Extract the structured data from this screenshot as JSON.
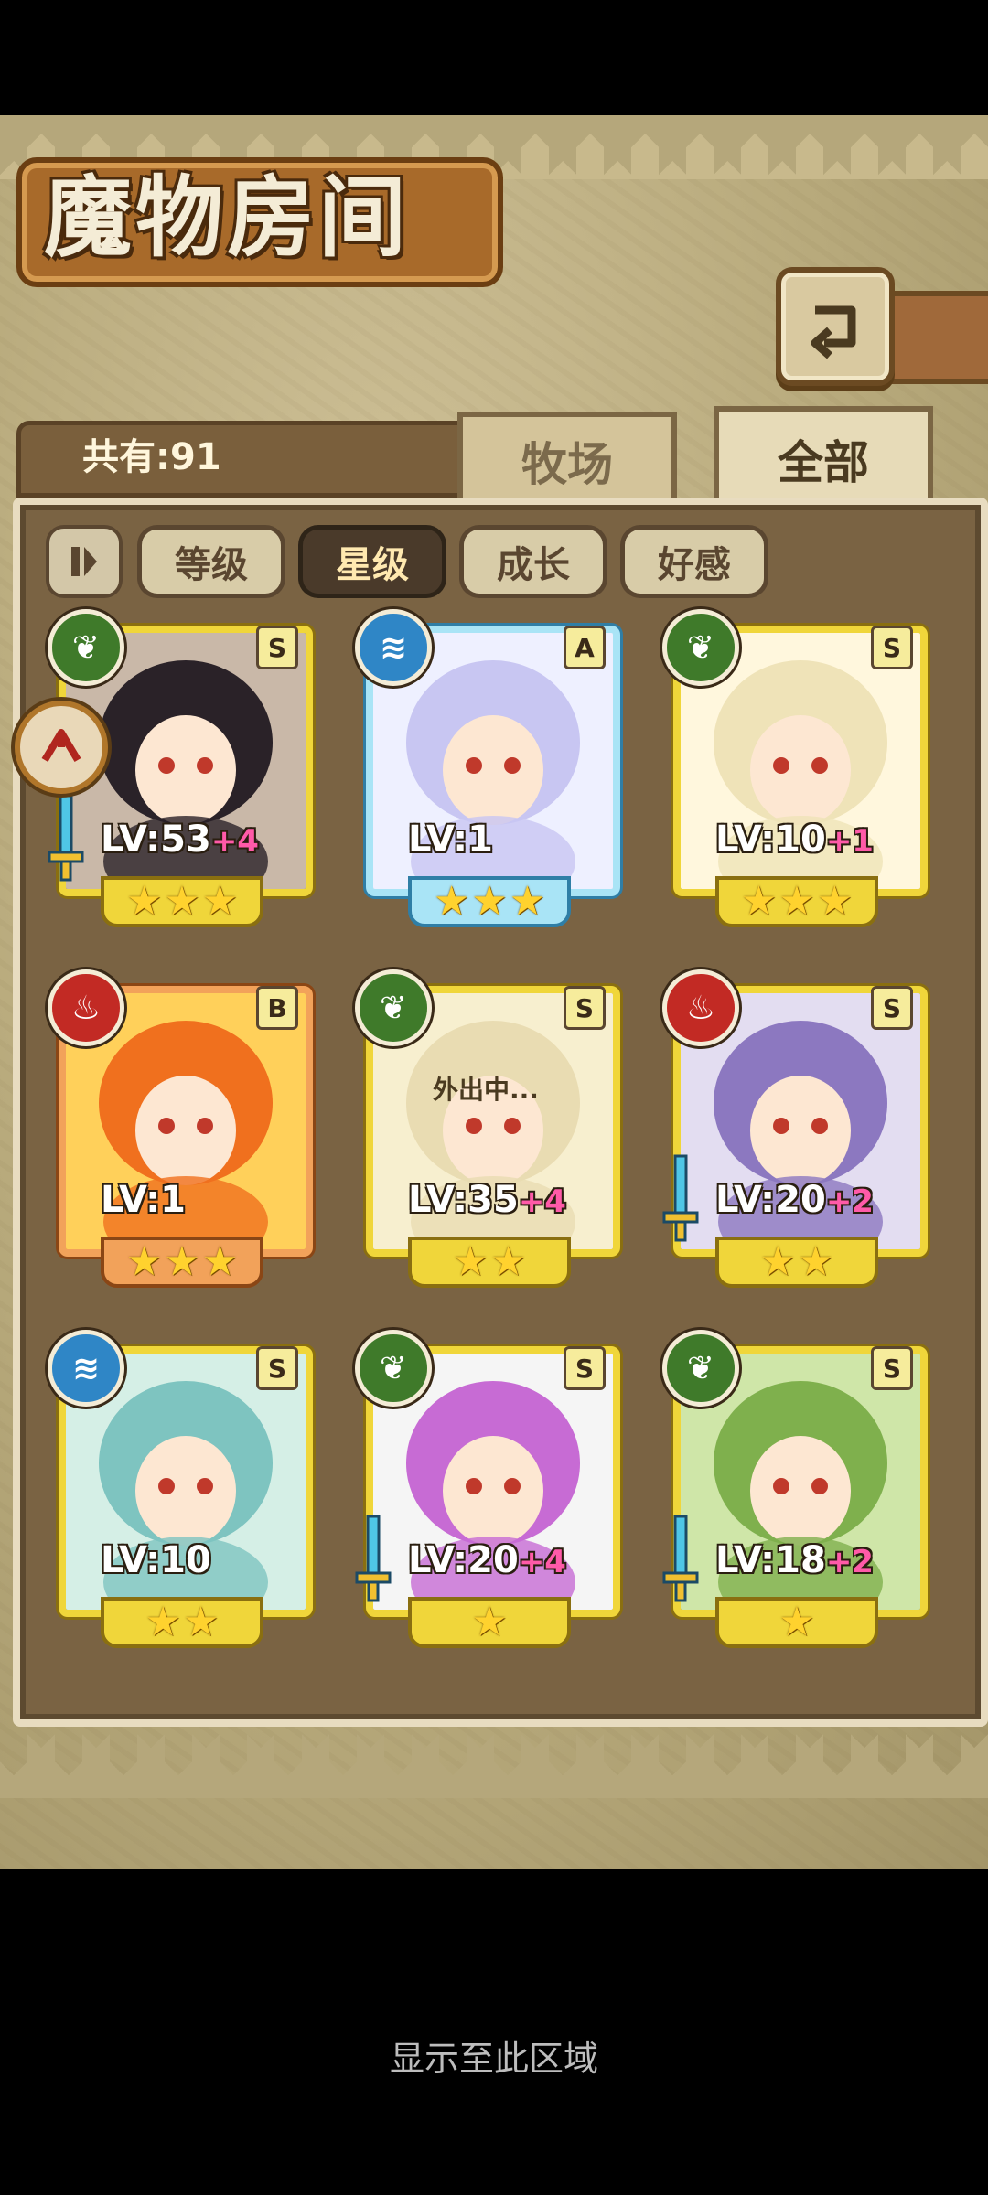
{
  "header": {
    "title": "魔物房间",
    "back_icon": "back-return-icon"
  },
  "summary": {
    "count_label": "共有:91"
  },
  "tabs": [
    {
      "label": "牧场",
      "active": false
    },
    {
      "label": "全部",
      "active": true
    }
  ],
  "filters": {
    "pause_icon": "pause-icon",
    "items": [
      {
        "label": "等级",
        "active": false
      },
      {
        "label": "星级",
        "active": true
      },
      {
        "label": "成长",
        "active": false
      },
      {
        "label": "好感",
        "active": false
      }
    ]
  },
  "monsters": [
    {
      "element": "leaf",
      "rank": "S",
      "lv": "LV:53",
      "plus": "+4",
      "stars": 3,
      "weapon": true,
      "frame": "gold",
      "status": ""
    },
    {
      "element": "water",
      "rank": "A",
      "lv": "LV:1",
      "plus": "",
      "stars": 3,
      "weapon": false,
      "frame": "blue",
      "status": ""
    },
    {
      "element": "leaf",
      "rank": "S",
      "lv": "LV:10",
      "plus": "+1",
      "stars": 3,
      "weapon": false,
      "frame": "gold",
      "status": ""
    },
    {
      "element": "fire",
      "rank": "B",
      "lv": "LV:1",
      "plus": "",
      "stars": 3,
      "weapon": false,
      "frame": "orange",
      "status": ""
    },
    {
      "element": "leaf",
      "rank": "S",
      "lv": "LV:35",
      "plus": "+4",
      "stars": 2,
      "weapon": false,
      "frame": "gold",
      "status": "外出中..."
    },
    {
      "element": "fire",
      "rank": "S",
      "lv": "LV:20",
      "plus": "+2",
      "stars": 2,
      "weapon": true,
      "frame": "gold",
      "status": ""
    },
    {
      "element": "water",
      "rank": "S",
      "lv": "LV:10",
      "plus": "",
      "stars": 2,
      "weapon": false,
      "frame": "gold",
      "status": ""
    },
    {
      "element": "leaf",
      "rank": "S",
      "lv": "LV:20",
      "plus": "+4",
      "stars": 1,
      "weapon": true,
      "frame": "gold",
      "status": ""
    },
    {
      "element": "leaf",
      "rank": "S",
      "lv": "LV:18",
      "plus": "+2",
      "stars": 1,
      "weapon": true,
      "frame": "gold",
      "status": ""
    }
  ],
  "side_badge_icon": "hook-badge-icon",
  "footer": {
    "hint": "显示至此区域"
  },
  "colors": {
    "frame_gold": "#f0d63a",
    "frame_blue": "#a9e4f6",
    "frame_orange": "#f2a25a",
    "plus_pink": "#ff5aa8"
  }
}
